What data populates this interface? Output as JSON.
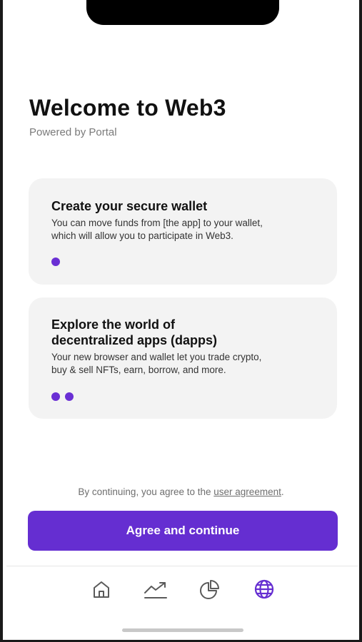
{
  "header": {
    "title": "Welcome to Web3",
    "subtitle": "Powered by Portal"
  },
  "cards": [
    {
      "title": "Create your secure wallet",
      "body_lines": [
        "You can move funds from [the app] to your wallet,",
        "which will allow you to participate in Web3."
      ],
      "step_dots": 1
    },
    {
      "title_lines": [
        "Explore the world of",
        "decentralized apps (dapps)"
      ],
      "body_lines": [
        "Your new browser and wallet let you trade crypto,",
        "buy & sell NFTs, earn, borrow, and more."
      ],
      "step_dots": 2
    }
  ],
  "agreement": {
    "prefix": "By continuing, you agree to the ",
    "link_text": "user agreement",
    "suffix": "."
  },
  "cta": {
    "label": "Agree and continue"
  },
  "tab_bar": {
    "items": [
      {
        "icon": "home-icon",
        "active": false
      },
      {
        "icon": "trending-chart-icon",
        "active": false
      },
      {
        "icon": "pie-chart-icon",
        "active": false
      },
      {
        "icon": "globe-icon",
        "active": true
      }
    ]
  },
  "colors": {
    "accent": "#652ed1",
    "card_bg": "#f3f3f3",
    "icon_inactive": "#5a5a5a",
    "text_secondary": "#7a7a7a"
  }
}
